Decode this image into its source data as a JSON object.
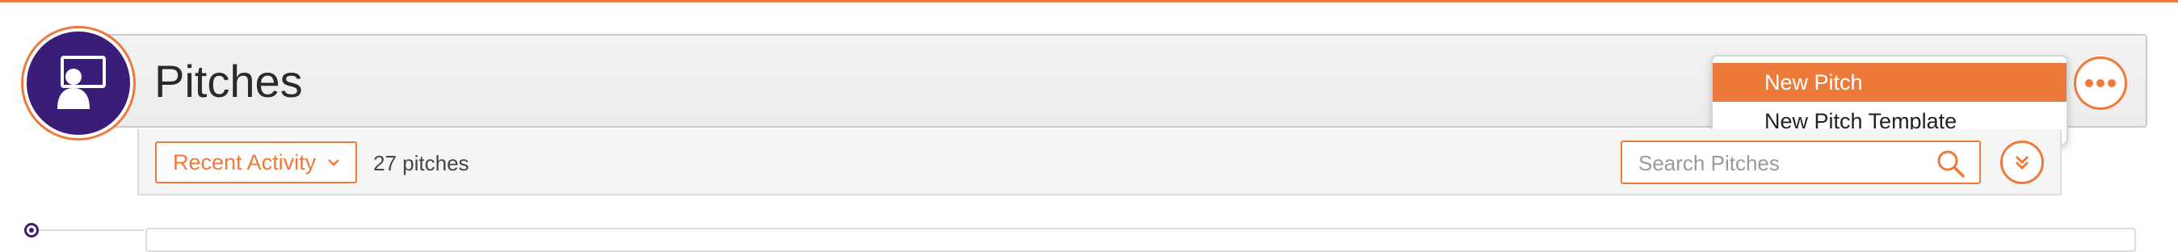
{
  "page": {
    "title": "Pitches",
    "avatar_icon": "presenter-screen-icon",
    "more_icon": "ellipsis-icon"
  },
  "menu": {
    "items": [
      {
        "label": "New Pitch",
        "active": true
      },
      {
        "label": "New Pitch Template",
        "active": false
      }
    ]
  },
  "toolbar": {
    "sort_label": "Recent Activity",
    "sort_icon": "chevron-down-icon",
    "count_text": "27 pitches",
    "search_placeholder": "Search Pitches",
    "search_icon": "search-icon",
    "expand_icon": "double-chevron-down-icon"
  },
  "colors": {
    "accent": "#ed7a3b",
    "brand": "#3a1d78",
    "header_bg": "#efefef"
  }
}
